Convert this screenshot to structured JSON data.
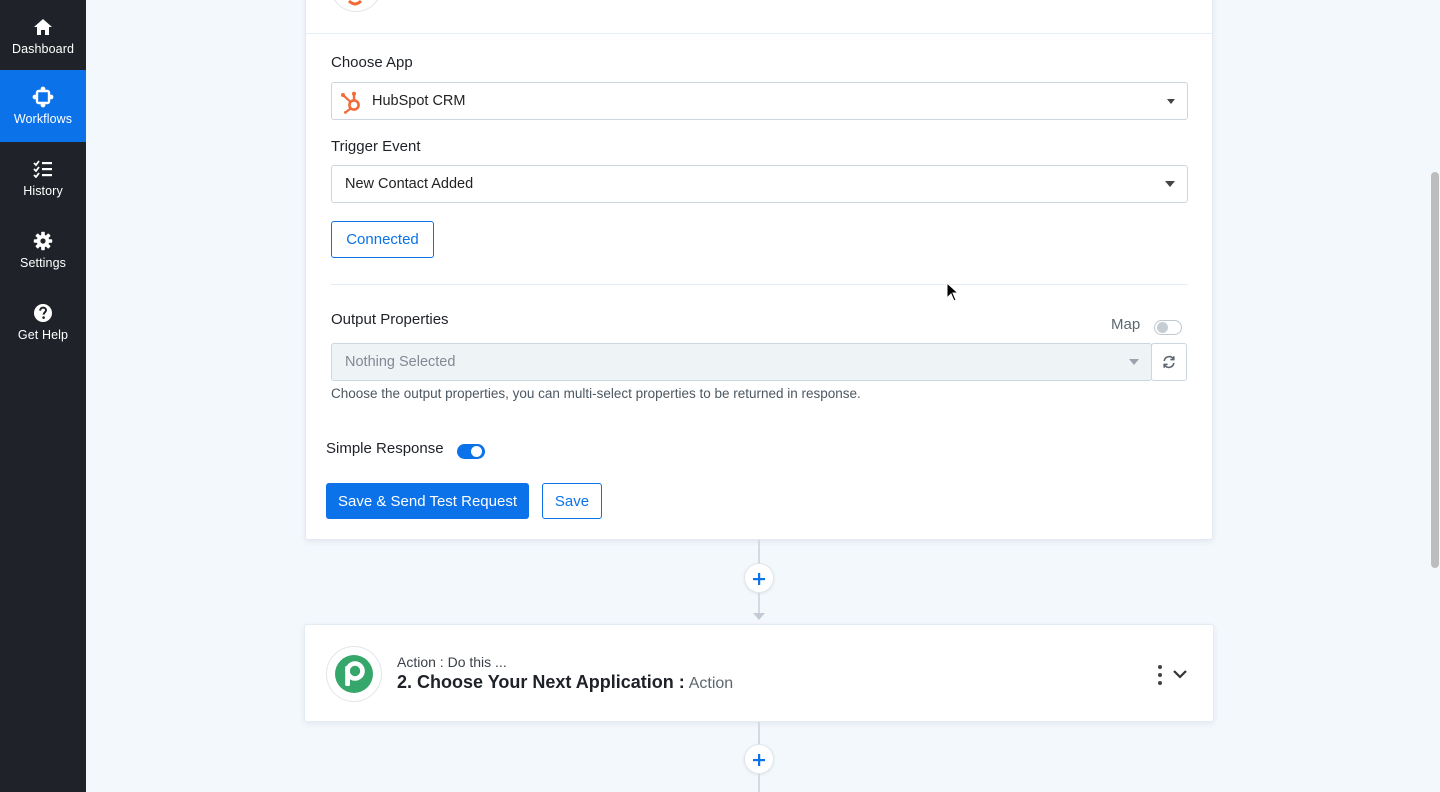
{
  "sidebar": {
    "items": [
      {
        "label": "Dashboard",
        "icon": "home-icon"
      },
      {
        "label": "Workflows",
        "icon": "workflow-icon",
        "active": true
      },
      {
        "label": "History",
        "icon": "list-check-icon"
      },
      {
        "label": "Settings",
        "icon": "gear-icon"
      },
      {
        "label": "Get Help",
        "icon": "question-circle-icon"
      }
    ]
  },
  "trigger": {
    "choose_app_label": "Choose App",
    "app_value": "HubSpot CRM",
    "app_icon": "hubspot-logo-icon",
    "trigger_event_label": "Trigger Event",
    "trigger_event_value": "New Contact Added",
    "connected_label": "Connected",
    "output_properties_label": "Output Properties",
    "map_label": "Map",
    "map_enabled": false,
    "output_placeholder": "Nothing Selected",
    "output_helper": "Choose the output properties, you can multi-select properties to be returned in response.",
    "simple_response_label": "Simple Response",
    "simple_response_enabled": true,
    "save_send_label": "Save & Send Test Request",
    "save_label": "Save"
  },
  "action": {
    "kicker": "Action : Do this ...",
    "title": "2. Choose Your Next Application :",
    "subtitle": "Action",
    "icon": "pabbly-logo-icon"
  },
  "colors": {
    "accent": "#0b72ea",
    "sidebar_bg": "#1f2329",
    "hubspot": "#f26a37",
    "pabbly": "#36a76a"
  }
}
